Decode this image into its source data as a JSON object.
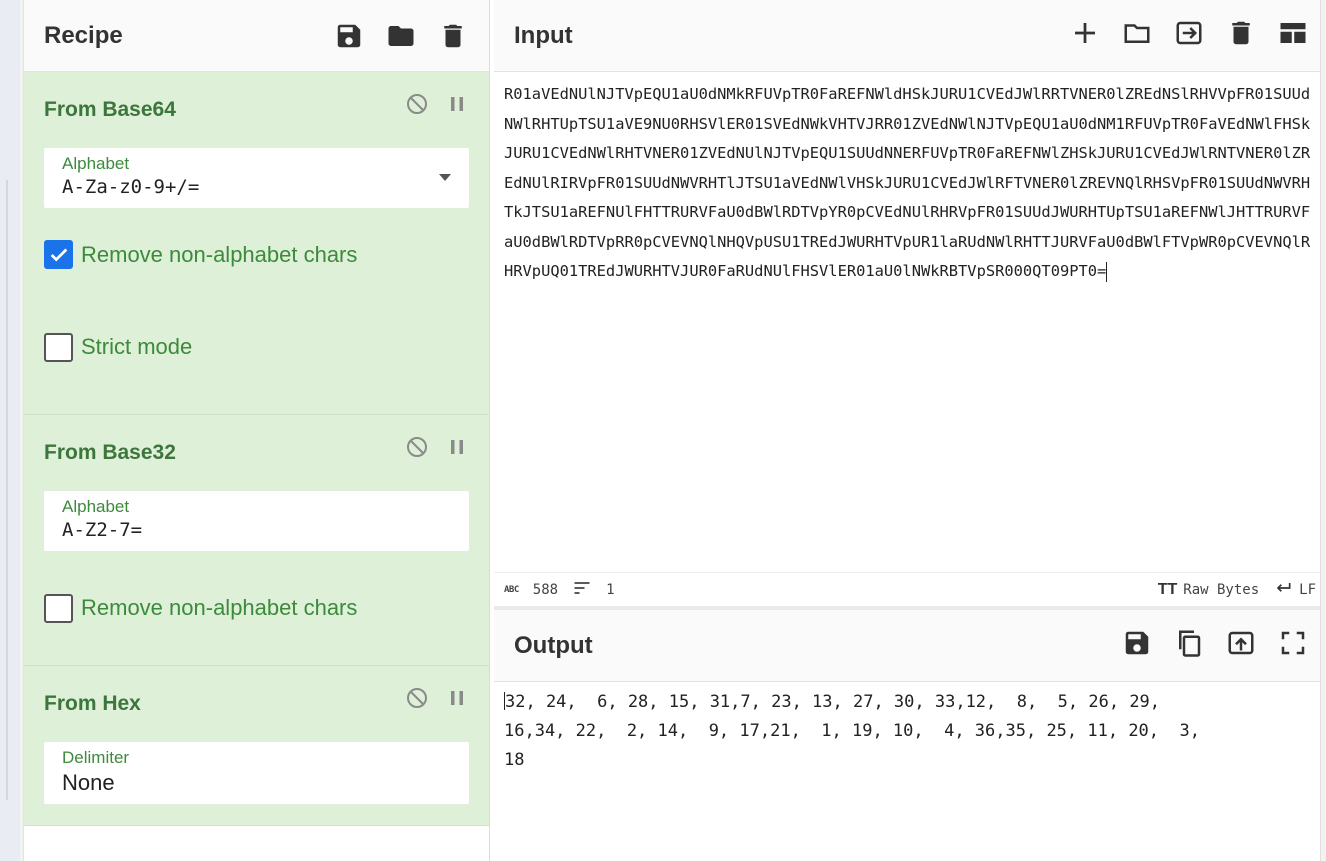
{
  "recipe": {
    "title": "Recipe",
    "operations": [
      {
        "title": "From Base64",
        "fields": [
          {
            "label": "Alphabet",
            "value": "A-Za-z0-9+/=",
            "dropdown": true
          }
        ],
        "checkboxes": [
          {
            "label": "Remove non-alphabet chars",
            "checked": true
          },
          {
            "label": "Strict mode",
            "checked": false
          }
        ]
      },
      {
        "title": "From Base32",
        "fields": [
          {
            "label": "Alphabet",
            "value": "A-Z2-7="
          }
        ],
        "checkboxes": [
          {
            "label": "Remove non-alphabet chars",
            "checked": false
          }
        ]
      },
      {
        "title": "From Hex",
        "fields": [
          {
            "label": "Delimiter",
            "value": "None"
          }
        ]
      }
    ]
  },
  "input": {
    "title": "Input",
    "text": "R01aVEdNUlNJTVpEQU1aU0dNMkRFUVpTR0FaREFNWldHSkJURU1CVEdJWlRRTVNER0lZREdNSlRHVVpFR01SUUdNWlRHTUpTSU1aVE9NU0RHSVlER01SVEdNWkVHTVJRR01ZVEdNWlNJTVpEQU1aU0dNM1RFUVpTR0FaVEdNWlFHSkJURU1CVEdNWlRHTVNER01ZVEdNUlNJTVpEQU1SUUdNNERFUVpTR0FaREFNWlZHSkJURU1CVEdJWlRNTVNER0lZREdNUlRIRVpFR01SUUdNWVRHTlJTSU1aVEdNWlVHSkJURU1CVEdJWlRFTVNER0lZREVNQlRHSVpFR01SUUdNWVRHTkJTSU1aREFNUlFHTTRURVFaU0dBWlRDTVpYR0pCVEdNUlRHRVpFR01SUUdJWURHTUpTSU1aREFNWlJHTTRURVFaU0dBWlRDTVpRR0pCVEVNQlNHQVpUSU1TREdJWURHTVpUR1laRUdNWlRHTTJURVFaU0dBWlFTVpWR0pCVEVNQlRHRVpUQ01TREdJWURHTVJUR0FaRUdNUlFHSVlER01aU0lNWkRBTVpSR000QT09PT0=",
    "stats": {
      "length": "588",
      "lines": "1"
    },
    "encoding": "Raw Bytes",
    "eol": "LF"
  },
  "output": {
    "title": "Output",
    "text": "32, 24,  6, 28, 15, 31,7, 23, 13, 27, 30, 33,12,  8,  5, 26, 29,\n16,34, 22,  2, 14,  9, 17,21,  1, 19, 10,  4, 36,35, 25, 11, 20,  3,\n18"
  }
}
